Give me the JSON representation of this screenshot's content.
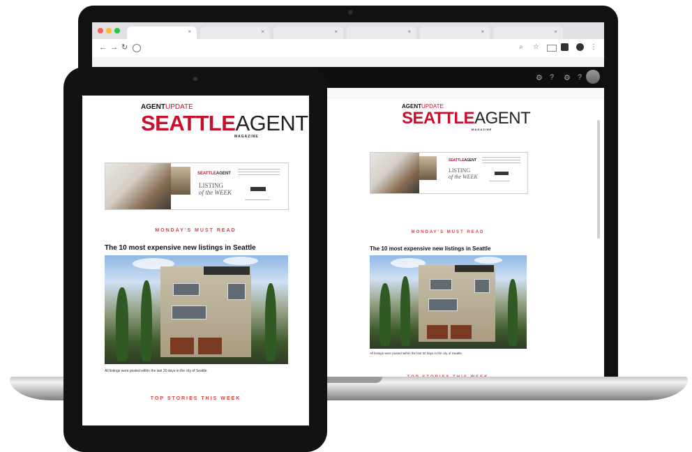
{
  "newsletter": {
    "logo_top_agent": "AGENT",
    "logo_top_update": "UPDATE",
    "logo_seattle": "SEATTLE",
    "logo_agent": "AGENT",
    "logo_magazine": "MAGAZINE",
    "banner_listing": "LISTING",
    "banner_week": "of the WEEK",
    "kicker": "MONDAY'S MUST READ",
    "headline": "The 10 most expensive new listings in Seattle",
    "caption": "All listings were posted within the last 30 days in the city of Seattle.",
    "section_top_stories": "TOP STORIES THIS WEEK"
  },
  "colors": {
    "brand_red": "#c8102e",
    "kicker_red": "#e03a3a"
  },
  "icons": {
    "back": "←",
    "forward": "→",
    "reload": "↻",
    "star": "☆",
    "menu": "⋮"
  }
}
